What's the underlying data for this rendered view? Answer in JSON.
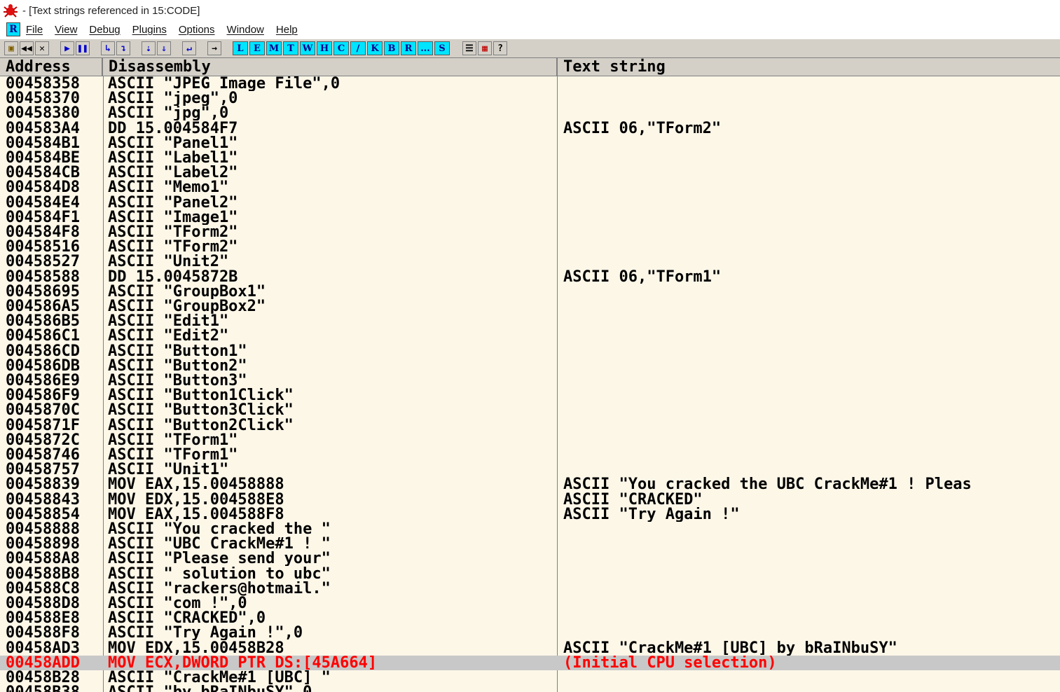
{
  "window": {
    "title": " - [Text strings referenced in 15:CODE]"
  },
  "menu": [
    "File",
    "View",
    "Debug",
    "Plugins",
    "Options",
    "Window",
    "Help"
  ],
  "toolbar": {
    "letters": [
      "L",
      "E",
      "M",
      "T",
      "W",
      "H",
      "C",
      "/",
      "K",
      "B",
      "R",
      "...",
      "S"
    ]
  },
  "columns": {
    "address": "Address",
    "disassembly": "Disassembly",
    "text": "Text string"
  },
  "rows": [
    {
      "addr": "00458358",
      "dis": "ASCII \"JPEG Image File\",0",
      "txt": ""
    },
    {
      "addr": "00458370",
      "dis": "ASCII \"jpeg\",0",
      "txt": ""
    },
    {
      "addr": "00458380",
      "dis": "ASCII \"jpg\",0",
      "txt": ""
    },
    {
      "addr": "004583A4",
      "dis": "DD 15.004584F7",
      "txt": "ASCII 06,\"TForm2\""
    },
    {
      "addr": "004584B1",
      "dis": "ASCII \"Panel1\"",
      "txt": ""
    },
    {
      "addr": "004584BE",
      "dis": "ASCII \"Label1\"",
      "txt": ""
    },
    {
      "addr": "004584CB",
      "dis": "ASCII \"Label2\"",
      "txt": ""
    },
    {
      "addr": "004584D8",
      "dis": "ASCII \"Memo1\"",
      "txt": ""
    },
    {
      "addr": "004584E4",
      "dis": "ASCII \"Panel2\"",
      "txt": ""
    },
    {
      "addr": "004584F1",
      "dis": "ASCII \"Image1\"",
      "txt": ""
    },
    {
      "addr": "004584F8",
      "dis": "ASCII \"TForm2\"",
      "txt": ""
    },
    {
      "addr": "00458516",
      "dis": "ASCII \"TForm2\"",
      "txt": ""
    },
    {
      "addr": "00458527",
      "dis": "ASCII \"Unit2\"",
      "txt": ""
    },
    {
      "addr": "00458588",
      "dis": "DD 15.0045872B",
      "txt": "ASCII 06,\"TForm1\""
    },
    {
      "addr": "00458695",
      "dis": "ASCII \"GroupBox1\"",
      "txt": ""
    },
    {
      "addr": "004586A5",
      "dis": "ASCII \"GroupBox2\"",
      "txt": ""
    },
    {
      "addr": "004586B5",
      "dis": "ASCII \"Edit1\"",
      "txt": ""
    },
    {
      "addr": "004586C1",
      "dis": "ASCII \"Edit2\"",
      "txt": ""
    },
    {
      "addr": "004586CD",
      "dis": "ASCII \"Button1\"",
      "txt": ""
    },
    {
      "addr": "004586DB",
      "dis": "ASCII \"Button2\"",
      "txt": ""
    },
    {
      "addr": "004586E9",
      "dis": "ASCII \"Button3\"",
      "txt": ""
    },
    {
      "addr": "004586F9",
      "dis": "ASCII \"Button1Click\"",
      "txt": ""
    },
    {
      "addr": "0045870C",
      "dis": "ASCII \"Button3Click\"",
      "txt": ""
    },
    {
      "addr": "0045871F",
      "dis": "ASCII \"Button2Click\"",
      "txt": ""
    },
    {
      "addr": "0045872C",
      "dis": "ASCII \"TForm1\"",
      "txt": ""
    },
    {
      "addr": "00458746",
      "dis": "ASCII \"TForm1\"",
      "txt": ""
    },
    {
      "addr": "00458757",
      "dis": "ASCII \"Unit1\"",
      "txt": ""
    },
    {
      "addr": "00458839",
      "dis": "MOV EAX,15.00458888",
      "txt": "ASCII \"You cracked the UBC CrackMe#1 ! Pleas"
    },
    {
      "addr": "00458843",
      "dis": "MOV EDX,15.004588E8",
      "txt": "ASCII \"CRACKED\""
    },
    {
      "addr": "00458854",
      "dis": "MOV EAX,15.004588F8",
      "txt": "ASCII \"Try Again !\""
    },
    {
      "addr": "00458888",
      "dis": "ASCII \"You cracked the \"",
      "txt": ""
    },
    {
      "addr": "00458898",
      "dis": "ASCII \"UBC CrackMe#1 ! \"",
      "txt": ""
    },
    {
      "addr": "004588A8",
      "dis": "ASCII \"Please send your\"",
      "txt": ""
    },
    {
      "addr": "004588B8",
      "dis": "ASCII \" solution to ubc\"",
      "txt": ""
    },
    {
      "addr": "004588C8",
      "dis": "ASCII \"rackers@hotmail.\"",
      "txt": ""
    },
    {
      "addr": "004588D8",
      "dis": "ASCII \"com !\",0",
      "txt": ""
    },
    {
      "addr": "004588E8",
      "dis": "ASCII \"CRACKED\",0",
      "txt": ""
    },
    {
      "addr": "004588F8",
      "dis": "ASCII \"Try Again !\",0",
      "txt": ""
    },
    {
      "addr": "00458AD3",
      "dis": "MOV EDX,15.00458B28",
      "txt": "ASCII \"CrackMe#1 [UBC] by bRaINbuSY\""
    },
    {
      "addr": "00458ADD",
      "dis": "MOV ECX,DWORD PTR DS:[45A664]",
      "txt": "(Initial CPU selection)",
      "selected": true
    },
    {
      "addr": "00458B28",
      "dis": "ASCII \"CrackMe#1 [UBC] \"",
      "txt": ""
    },
    {
      "addr": "00458B38",
      "dis": "ASCII \"by bRaINbuSY\",0",
      "txt": ""
    }
  ]
}
